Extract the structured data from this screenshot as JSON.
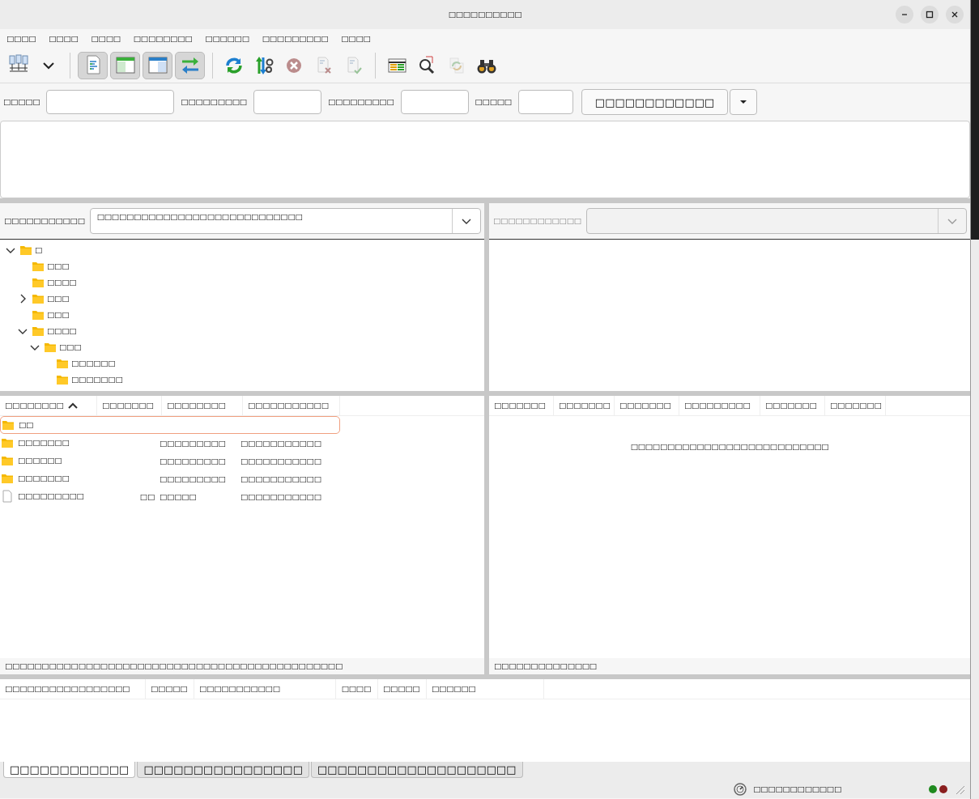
{
  "window": {
    "title": "□□□□□□□□□□"
  },
  "menu": [
    "□□□□",
    "□□□□",
    "□□□□",
    "□□□□□□□□",
    "□□□□□□",
    "□□□□□□□□□",
    "□□□□"
  ],
  "toolbar": [
    {
      "kind": "site-manager",
      "on": false,
      "disabled": false
    },
    {
      "kind": "dropdown",
      "on": false,
      "disabled": false
    },
    {
      "kind": "log",
      "on": true,
      "disabled": false
    },
    {
      "kind": "local-tree",
      "on": true,
      "disabled": false
    },
    {
      "kind": "remote-tree",
      "on": true,
      "disabled": false
    },
    {
      "kind": "queue",
      "on": true,
      "disabled": false
    },
    {
      "kind": "refresh",
      "on": false,
      "disabled": false
    },
    {
      "kind": "filters",
      "on": false,
      "disabled": false
    },
    {
      "kind": "cancel",
      "on": false,
      "disabled": true
    },
    {
      "kind": "disconnect",
      "on": false,
      "disabled": true
    },
    {
      "kind": "reconnect",
      "on": false,
      "disabled": true
    },
    {
      "kind": "compare",
      "on": false,
      "disabled": false
    },
    {
      "kind": "search",
      "on": false,
      "disabled": false
    },
    {
      "kind": "sync",
      "on": false,
      "disabled": true
    },
    {
      "kind": "find",
      "on": false,
      "disabled": false
    }
  ],
  "quickconnect": {
    "fields": [
      {
        "label": "□□□□□"
      },
      {
        "label": "□□□□□□□□□"
      },
      {
        "label": "□□□□□□□□□"
      },
      {
        "label": "□□□□□"
      }
    ],
    "button": "□□□□□□□□□□□□"
  },
  "local_site": {
    "label": "□□□□□□□□□□□",
    "path": "□□□□□□□□□□□□□□□□□□□□□□□□□□□□"
  },
  "remote_site": {
    "label": "□□□□□□□□□□□□",
    "disabled": true
  },
  "local_tree": [
    {
      "label": "□",
      "expanded": true,
      "children": [
        {
          "label": "□□□",
          "expanded": false
        },
        {
          "label": "□□□□",
          "expanded": false
        },
        {
          "label": "□□□",
          "expanded": false,
          "has_children": true
        },
        {
          "label": "□□□",
          "expanded": false
        },
        {
          "label": "□□□□",
          "expanded": true,
          "children": [
            {
              "label": "□□□",
              "expanded": true,
              "children": [
                {
                  "label": "□□□□□□",
                  "expanded": false
                },
                {
                  "label": "□□□□□□□",
                  "expanded": false
                }
              ]
            }
          ]
        }
      ]
    }
  ],
  "local_list": {
    "columns": [
      {
        "label": "□□□□□□□□",
        "sorted": true
      },
      {
        "label": "□□□□□□□",
        "sorted": false
      },
      {
        "label": "□□□□□□□□",
        "sorted": false
      },
      {
        "label": "□□□□□□□□□□□",
        "sorted": false
      }
    ],
    "rows": [
      {
        "kind": "folder",
        "selected": true,
        "name": "□□"
      },
      {
        "kind": "folder",
        "selected": false,
        "name": "□□□□□□□",
        "type": "□□□□□□□□□",
        "modified": "□□□□□□□□□□□"
      },
      {
        "kind": "folder",
        "selected": false,
        "name": "□□□□□□",
        "type": "□□□□□□□□□",
        "modified": "□□□□□□□□□□□"
      },
      {
        "kind": "folder",
        "selected": false,
        "name": "□□□□□□□",
        "type": "□□□□□□□□□",
        "modified": "□□□□□□□□□□□"
      },
      {
        "kind": "file",
        "selected": false,
        "name": "□□□□□□□□□",
        "size": "□□",
        "type": "□□□□□",
        "modified": "□□□□□□□□□□□"
      }
    ],
    "status": "□□□□□□□□□□□□□□□□□□□□□□□□□□□□□□□□□□□□□□□□□□□□□□"
  },
  "remote_list": {
    "columns": [
      "□□□□□□□",
      "□□□□□□□",
      "□□□□□□□",
      "□□□□□□□□□",
      "□□□□□□□",
      "□□□□□□□"
    ],
    "message": "□□□□□□□□□□□□□□□□□□□□□□□□□□□",
    "status": "□□□□□□□□□□□□□□"
  },
  "queue": {
    "columns": [
      "□□□□□□□□□□□□□□□□□",
      "□□□□□",
      "□□□□□□□□□□□",
      "□□□□",
      "□□□□□",
      "□□□□□□"
    ]
  },
  "tabs": [
    {
      "label": "□□□□□□□□□□□□",
      "selected": true
    },
    {
      "label": "□□□□□□□□□□□□□□□□",
      "selected": false
    },
    {
      "label": "□□□□□□□□□□□□□□□□□□□□",
      "selected": false
    }
  ],
  "status_bar": {
    "text": "□□□□□□□□□□□□",
    "lights": [
      {
        "color": "#1f8a1f"
      },
      {
        "color": "#8a1f1f"
      }
    ]
  }
}
